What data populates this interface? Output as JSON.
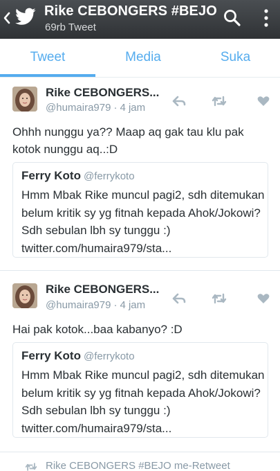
{
  "header": {
    "title": "Rike CEBONGERS #BEJO",
    "subtitle": "69rb Tweet"
  },
  "tabs": [
    {
      "label": "Tweet",
      "active": true
    },
    {
      "label": "Media",
      "active": false
    },
    {
      "label": "Suka",
      "active": false
    }
  ],
  "tweets": [
    {
      "name": "Rike CEBONGERS...",
      "handle": "@humaira979",
      "time": "4 jam",
      "text": "Ohhh nunggu ya?? Maap aq gak tau klu pak kotok nunggu aq..:D",
      "quote": {
        "name": "Ferry Koto",
        "handle": "@ferrykoto",
        "text": "Hmm Mbak Rike muncul pagi2, sdh ditemukan belum kritik sy yg fitnah kepada Ahok/Jokowi? Sdh sebulan lbh sy tunggu :) twitter.com/humaira979/sta..."
      }
    },
    {
      "name": "Rike CEBONGERS...",
      "handle": "@humaira979",
      "time": "4 jam",
      "text": "Hai pak kotok...baa kabanyo? :D",
      "quote": {
        "name": "Ferry Koto",
        "handle": "@ferrykoto",
        "text": "Hmm Mbak Rike muncul pagi2, sdh ditemukan belum kritik sy yg fitnah kepada Ahok/Jokowi? Sdh sebulan lbh sy tunggu :) twitter.com/humaira979/sta..."
      }
    }
  ],
  "retweet_banner": "Rike CEBONGERS #BEJO me-Retweet",
  "colors": {
    "accent": "#55acee",
    "header_bg": "#3a3d40",
    "meta_text": "#8899a6",
    "icon_gray": "#aab8c2"
  },
  "icons": {
    "back": "chevron-left-icon",
    "logo": "twitter-bird-icon",
    "search": "search-icon",
    "more": "more-vertical-icon",
    "reply": "reply-icon",
    "retweet": "retweet-icon",
    "like": "heart-icon"
  }
}
